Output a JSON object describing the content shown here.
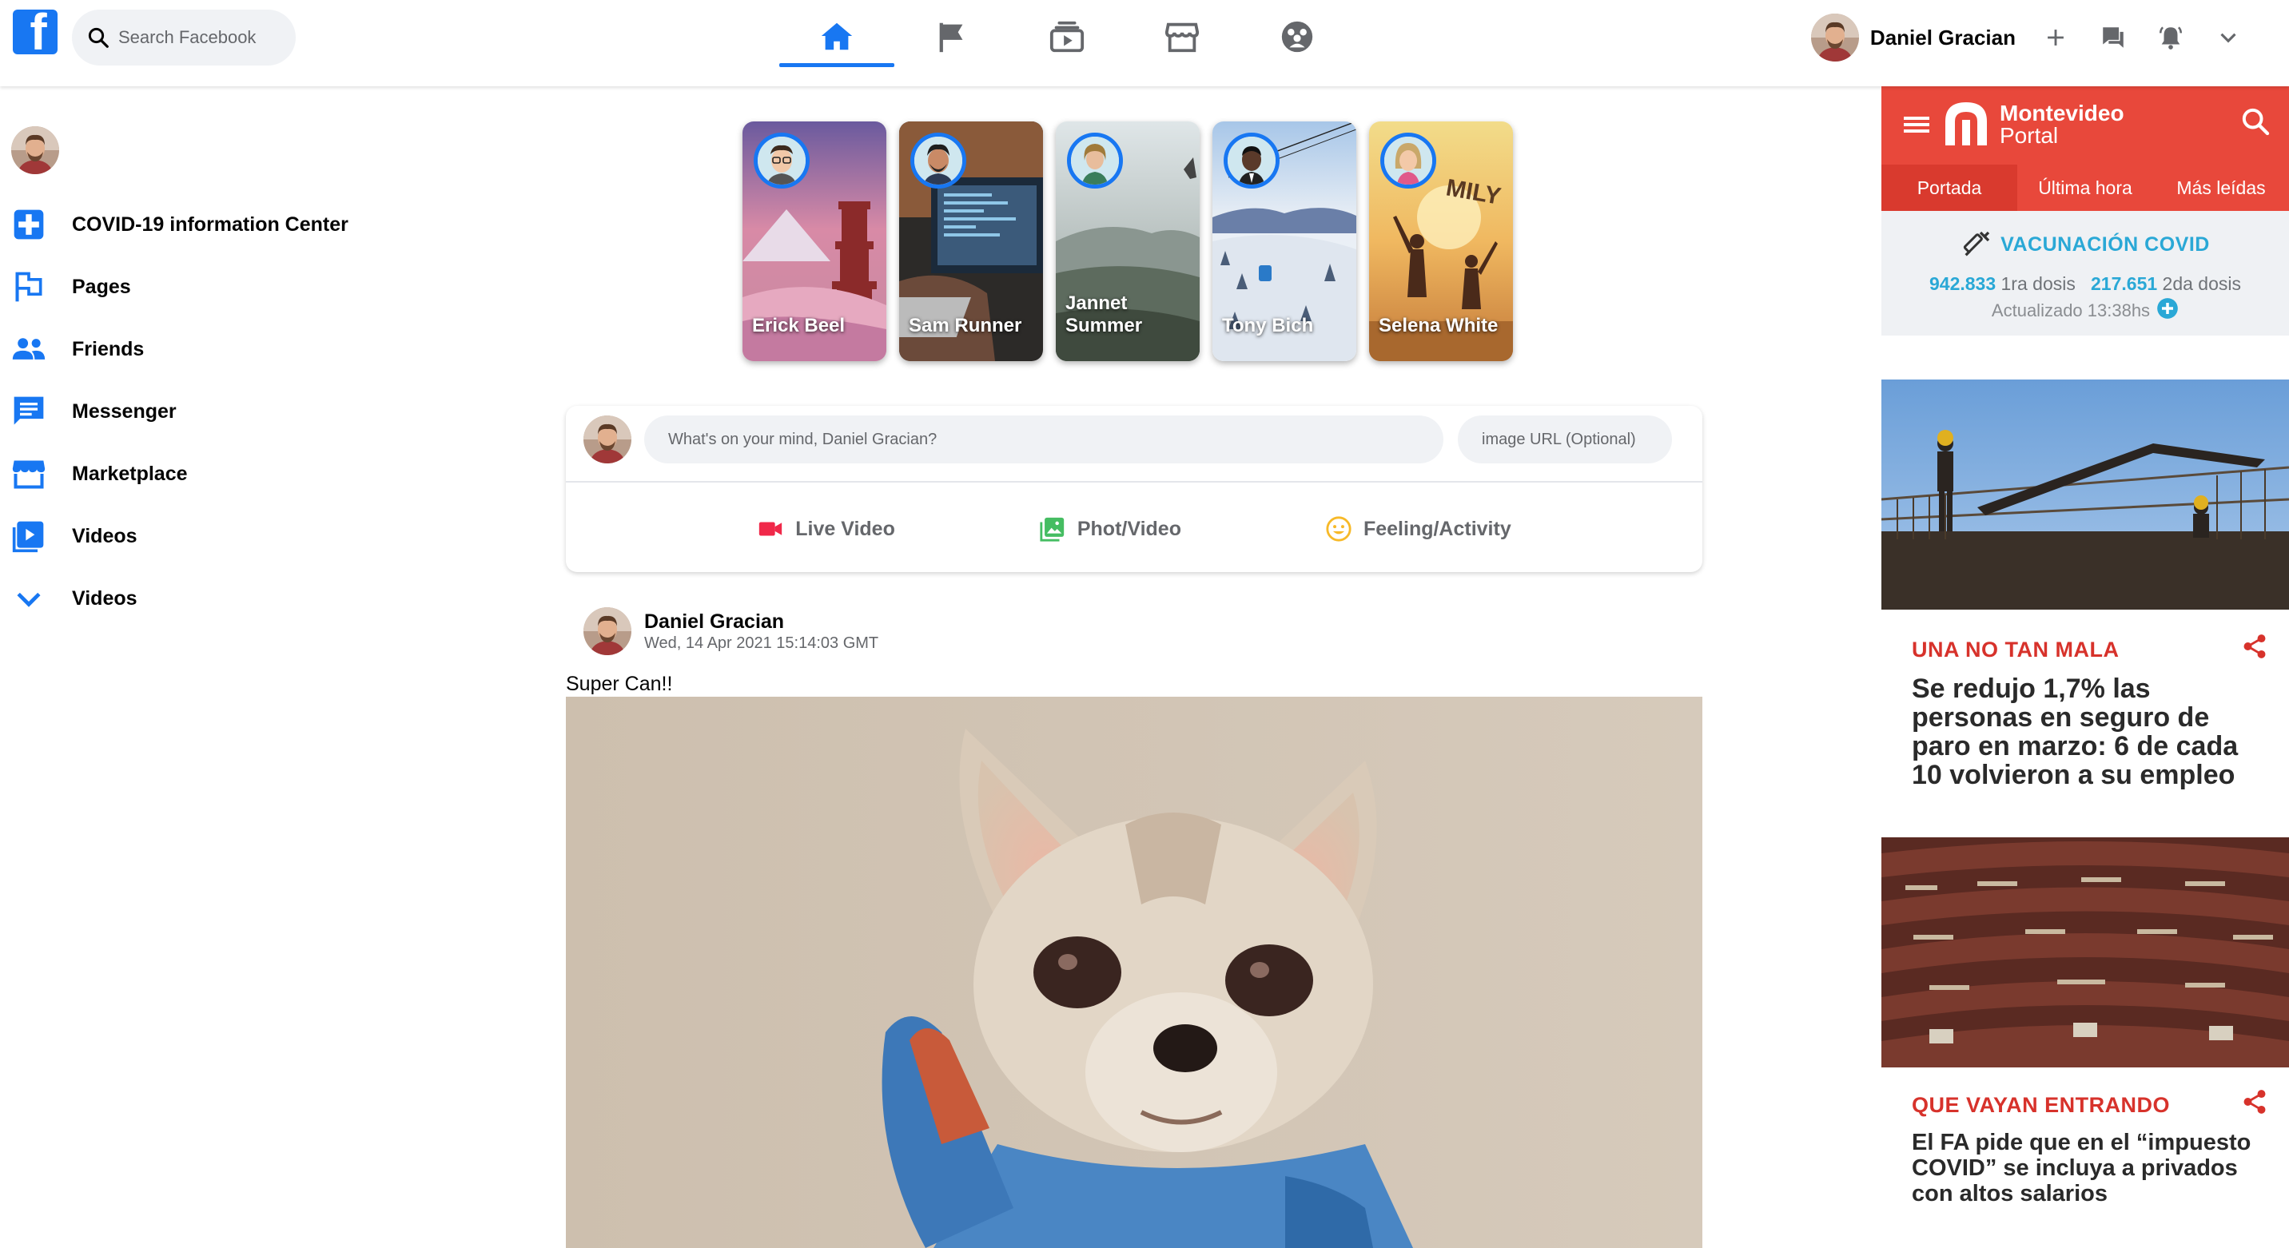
{
  "header": {
    "logo_letter": "f",
    "search_placeholder": "Search Facebook",
    "nav": [
      "home-icon",
      "pages-flag-icon",
      "watch-icon",
      "marketplace-icon",
      "groups-icon"
    ],
    "user_name": "Daniel Gracian",
    "colors": {
      "brand": "#1877f2",
      "icon": "#65676b"
    }
  },
  "sidebar": {
    "items": [
      {
        "label": "COVID-19 information Center",
        "icon": "covid-plus-icon"
      },
      {
        "label": "Pages",
        "icon": "flag-icon"
      },
      {
        "label": "Friends",
        "icon": "friends-icon"
      },
      {
        "label": "Messenger",
        "icon": "messenger-icon"
      },
      {
        "label": "Marketplace",
        "icon": "marketplace-icon"
      },
      {
        "label": "Videos",
        "icon": "video-icon"
      },
      {
        "label": "Videos",
        "icon": "chevron-down-icon"
      }
    ]
  },
  "stories": [
    {
      "name": "Erick Beel"
    },
    {
      "name": "Sam Runner"
    },
    {
      "name": "Jannet Summer"
    },
    {
      "name": "Tony Bich"
    },
    {
      "name": "Selena White"
    }
  ],
  "composer": {
    "status_placeholder": "What's on your mind, Daniel Gracian?",
    "url_placeholder": "image URL (Optional)",
    "actions": [
      {
        "label": "Live Video",
        "icon": "live-video-icon",
        "color": "#f02849"
      },
      {
        "label": "Phot/Video",
        "icon": "photo-icon",
        "color": "#45bd62"
      },
      {
        "label": "Feeling/Activity",
        "icon": "smiley-icon",
        "color": "#f7b928"
      }
    ]
  },
  "post": {
    "author": "Daniel Gracian",
    "date": "Wed, 14 Apr 2021 15:14:03 GMT",
    "text": "Super Can!!"
  },
  "portal": {
    "title_line1": "Montevideo",
    "title_line2": "Portal",
    "tabs": [
      "Portada",
      "Última hora",
      "Más leídas"
    ],
    "vaccine": {
      "heading": "VACUNACIÓN COVID",
      "first_dose_count": "942.833",
      "first_dose_label": "1ra dosis",
      "second_dose_count": "217.651",
      "second_dose_label": "2da dosis",
      "updated": "Actualizado 13:38hs"
    },
    "news": [
      {
        "tag": "UNA NO TAN MALA",
        "headline": "Se redujo 1,7% las personas en seguro de paro en marzo: 6 de cada 10 volvieron a su empleo"
      },
      {
        "tag": "QUE VAYAN ENTRANDO",
        "headline": "El FA pide que en el “impuesto COVID” se incluya a privados con altos salarios"
      }
    ],
    "colors": {
      "brand": "#e8483b",
      "accent": "#2aa8d6",
      "tag": "#d7322b"
    }
  }
}
